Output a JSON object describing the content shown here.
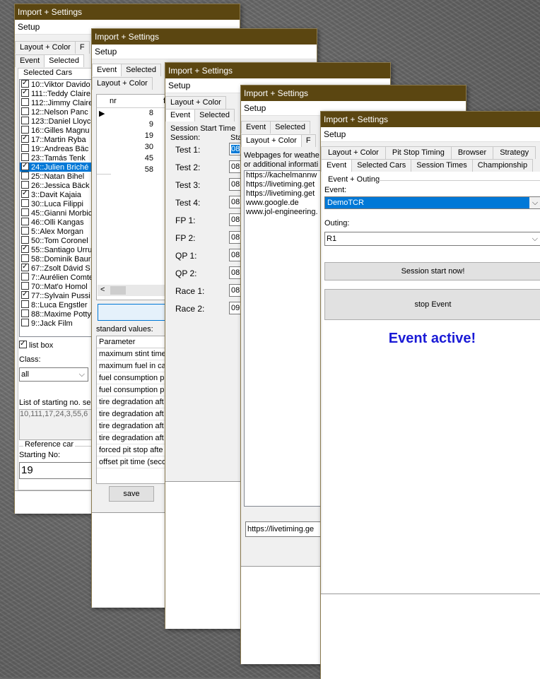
{
  "window_title": "Import + Settings",
  "menu_setup": "Setup",
  "w1": {
    "tabs_row1": [
      "Layout + Color",
      "F"
    ],
    "tabs_row2": [
      "Event",
      "Selected"
    ],
    "group_label": "Selected Cars",
    "cars": [
      {
        "label": "10::Viktor Davido",
        "checked": true
      },
      {
        "label": "111::Teddy Claire",
        "checked": true
      },
      {
        "label": "112::Jimmy Claire",
        "checked": false
      },
      {
        "label": "12::Nelson Panc",
        "checked": false
      },
      {
        "label": "123::Daniel Lloyc",
        "checked": false
      },
      {
        "label": "16::Gilles Magnu",
        "checked": false
      },
      {
        "label": "17::Martin Ryba",
        "checked": true
      },
      {
        "label": "19::Andreas Bäc",
        "checked": false
      },
      {
        "label": "23::Tamás Tenk",
        "checked": false
      },
      {
        "label": "24::Julien Briché",
        "checked": true
      },
      {
        "label": "25::Natan Bihel",
        "checked": false
      },
      {
        "label": "26::Jessica Bäck",
        "checked": false
      },
      {
        "label": "3::Davit Kajaia",
        "checked": true
      },
      {
        "label": "30::Luca Filippi",
        "checked": false
      },
      {
        "label": "45::Gianni Morbic",
        "checked": false
      },
      {
        "label": "46::Olli Kangas",
        "checked": false
      },
      {
        "label": "5::Alex Morgan",
        "checked": false
      },
      {
        "label": "50::Tom Coronel",
        "checked": false
      },
      {
        "label": "55::Santiago Urru",
        "checked": true
      },
      {
        "label": "58::Dominik Baur",
        "checked": false
      },
      {
        "label": "67::Zsolt Dávid S",
        "checked": true
      },
      {
        "label": "7::Aurélien Comte",
        "checked": false
      },
      {
        "label": "70::Mat'o Homol",
        "checked": false
      },
      {
        "label": "77::Sylvain Pussi",
        "checked": true
      },
      {
        "label": "8::Luca Engstler",
        "checked": false
      },
      {
        "label": "88::Maxime Potty",
        "checked": false
      },
      {
        "label": "9::Jack Film",
        "checked": false
      }
    ],
    "selected_car_index": 9,
    "list_box_label": "list box",
    "list_box_checked": true,
    "class_label": "Class:",
    "class_value": "all",
    "starting_list_label": "List of starting no. se",
    "starting_list_value": "10,111,17,24,3,55,6",
    "reference_group": "Reference car",
    "starting_no_label": "Starting No:",
    "starting_no_value": "19"
  },
  "w2": {
    "tabs_row1": [
      "Event",
      "Selected"
    ],
    "tabs_row2": [
      "Layout + Color"
    ],
    "grid_headers": [
      "nr",
      "fue"
    ],
    "grid_rows": [
      "8",
      "9",
      "19",
      "30",
      "45",
      "58"
    ],
    "standard_values_label": "standard values:",
    "params_header": "Parameter",
    "params": [
      "maximum stint time",
      "maximum fuel in ca",
      "fuel consumption p",
      "fuel consumption p",
      "tire degradation aft",
      "tire degradation aft",
      "tire degradation aft",
      "tire degradation aft",
      "forced pit stop afte",
      "offset pit time (seco"
    ],
    "save_label": "save"
  },
  "w3": {
    "tabs_row1": [
      "Layout + Color"
    ],
    "tabs_row2": [
      "Event",
      "Selected"
    ],
    "session_start_label": "Session Start Time",
    "session_col": "Session:",
    "start_col": "Sta",
    "sessions": [
      {
        "name": "Test 1:",
        "value": "08"
      },
      {
        "name": "Test 2:",
        "value": "08."
      },
      {
        "name": "Test 3:",
        "value": "08."
      },
      {
        "name": "Test 4:",
        "value": "08."
      },
      {
        "name": "FP 1:",
        "value": "08."
      },
      {
        "name": "FP 2:",
        "value": "08."
      },
      {
        "name": "QP 1:",
        "value": "08."
      },
      {
        "name": "QP 2:",
        "value": "08."
      },
      {
        "name": "Race 1:",
        "value": "08."
      },
      {
        "name": "Race 2:",
        "value": "09."
      }
    ]
  },
  "w4": {
    "tabs_row1": [
      "Event",
      "Selected"
    ],
    "tabs_row2": [
      "Layout + Color",
      "F"
    ],
    "info_line1": "Webpages for weathe",
    "info_line2": "or additional informati",
    "urls": [
      "https://kachelmannw",
      "https://livetiming.get",
      "https://livetiming.get",
      "www.google.de",
      "www.jol-engineering."
    ],
    "url_field": "https://livetiming.ge"
  },
  "w5": {
    "tabs_row1": [
      "Layout + Color",
      "Pit Stop Timing",
      "Browser",
      "Strategy"
    ],
    "tabs_row2": [
      "Event",
      "Selected Cars",
      "Session Times",
      "Championship"
    ],
    "group_label": "Event + Outing",
    "event_label": "Event:",
    "event_value": "DemoTCR",
    "outing_label": "Outing:",
    "outing_value": "R1",
    "session_start_btn": "Session start now!",
    "stop_event_btn": "stop Event",
    "status_text": "Event active!",
    "status_color": "#1a1ad6"
  },
  "colors": {
    "titlebar": "#5b4611",
    "selection": "#0078d7"
  }
}
